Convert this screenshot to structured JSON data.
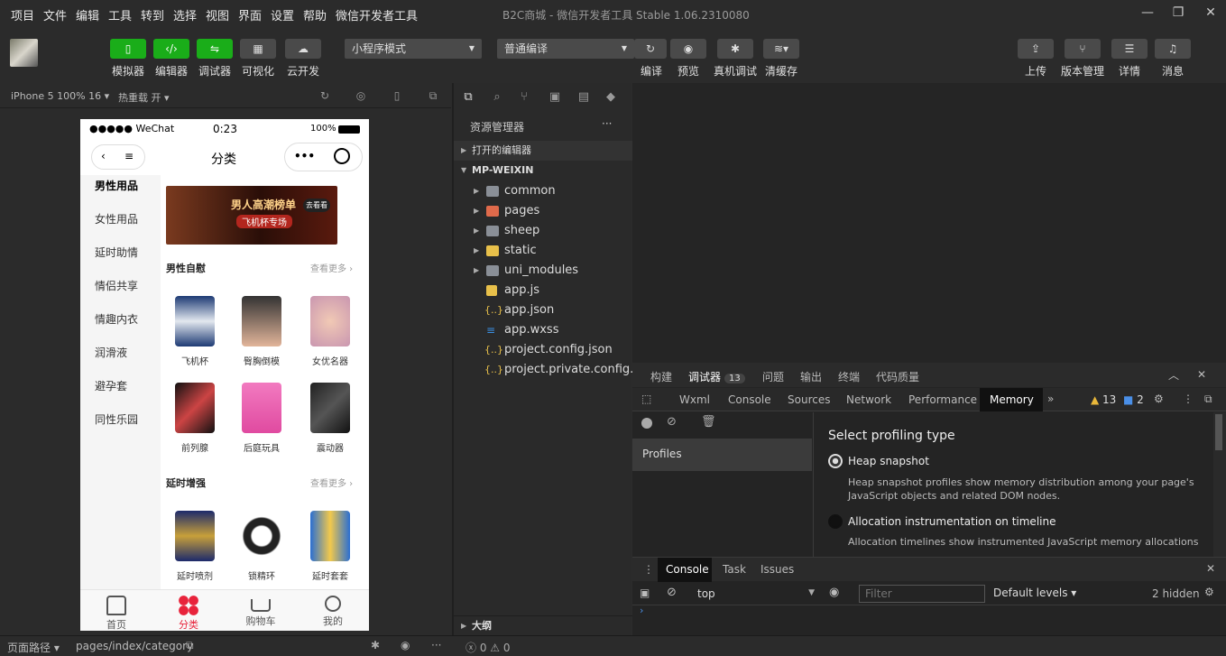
{
  "menubar": {
    "items": [
      "项目",
      "文件",
      "编辑",
      "工具",
      "转到",
      "选择",
      "视图",
      "界面",
      "设置",
      "帮助",
      "微信开发者工具"
    ],
    "title": "B2C商城 - 微信开发者工具 Stable 1.06.2310080"
  },
  "toolbar": {
    "left_buttons": [
      "模拟器",
      "编辑器",
      "调试器",
      "可视化",
      "云开发"
    ],
    "mode_select": "小程序模式",
    "compile_select": "普通编译",
    "mid_buttons": [
      "编译",
      "预览",
      "真机调试",
      "清缓存"
    ],
    "right_buttons": [
      "上传",
      "版本管理",
      "详情",
      "消息"
    ]
  },
  "simulator": {
    "device": "iPhone 5 100% 16",
    "hot_reload": "热重载 开",
    "status_left": "●●●●● WeChat",
    "status_time": "0:23",
    "status_battery": "100%",
    "page_title": "分类",
    "categories": [
      "男性用品",
      "女性用品",
      "延时助情",
      "情侣共享",
      "情趣内衣",
      "润滑液",
      "避孕套",
      "同性乐园"
    ],
    "banner_text": "男人高潮榜单",
    "banner_sub": "飞机杯专场",
    "banner_tag": "去看看",
    "section1": {
      "title": "男性自慰",
      "more": "查看更多 ›"
    },
    "section1_products": [
      "飞机杯",
      "臀胸倒模",
      "女优名器",
      "前列腺",
      "后庭玩具",
      "震动器"
    ],
    "section2": {
      "title": "延时增强",
      "more": "查看更多 ›"
    },
    "section2_products": [
      "延时喷剂",
      "锁精环",
      "延时套套"
    ],
    "tabbar": [
      "首页",
      "分类",
      "购物车",
      "我的"
    ]
  },
  "explorer": {
    "title": "资源管理器",
    "open_editors": "打开的编辑器",
    "root": "MP-WEIXIN",
    "folders": [
      "common",
      "pages",
      "sheep",
      "static",
      "uni_modules"
    ],
    "files": [
      "app.js",
      "app.json",
      "app.wxss",
      "project.config.json",
      "project.private.config.js..."
    ],
    "outline": "大纲"
  },
  "devtools": {
    "top_tabs": [
      "构建",
      "调试器",
      "问题",
      "输出",
      "终端",
      "代码质量"
    ],
    "debugger_badge": "13",
    "panel_tabs": [
      "Wxml",
      "Console",
      "Sources",
      "Network",
      "Performance",
      "Memory"
    ],
    "warn_count": "13",
    "info_count": "2",
    "profiles_label": "Profiles",
    "profiling_title": "Select profiling type",
    "option1_title": "Heap snapshot",
    "option1_desc": "Heap snapshot profiles show memory distribution among your page's JavaScript objects and related DOM nodes.",
    "option2_title": "Allocation instrumentation on timeline",
    "option2_desc": "Allocation timelines show instrumented JavaScript memory allocations",
    "drawer_tabs": [
      "Console",
      "Task",
      "Issues"
    ],
    "context": "top",
    "filter_placeholder": "Filter",
    "levels": "Default levels",
    "hidden": "2 hidden"
  },
  "statusbar": {
    "path_label": "页面路径",
    "path": "pages/index/category",
    "errors": "0",
    "warnings": "0"
  },
  "colors": {
    "accent_green": "#1aad19",
    "tab_active": "#e8233b"
  }
}
